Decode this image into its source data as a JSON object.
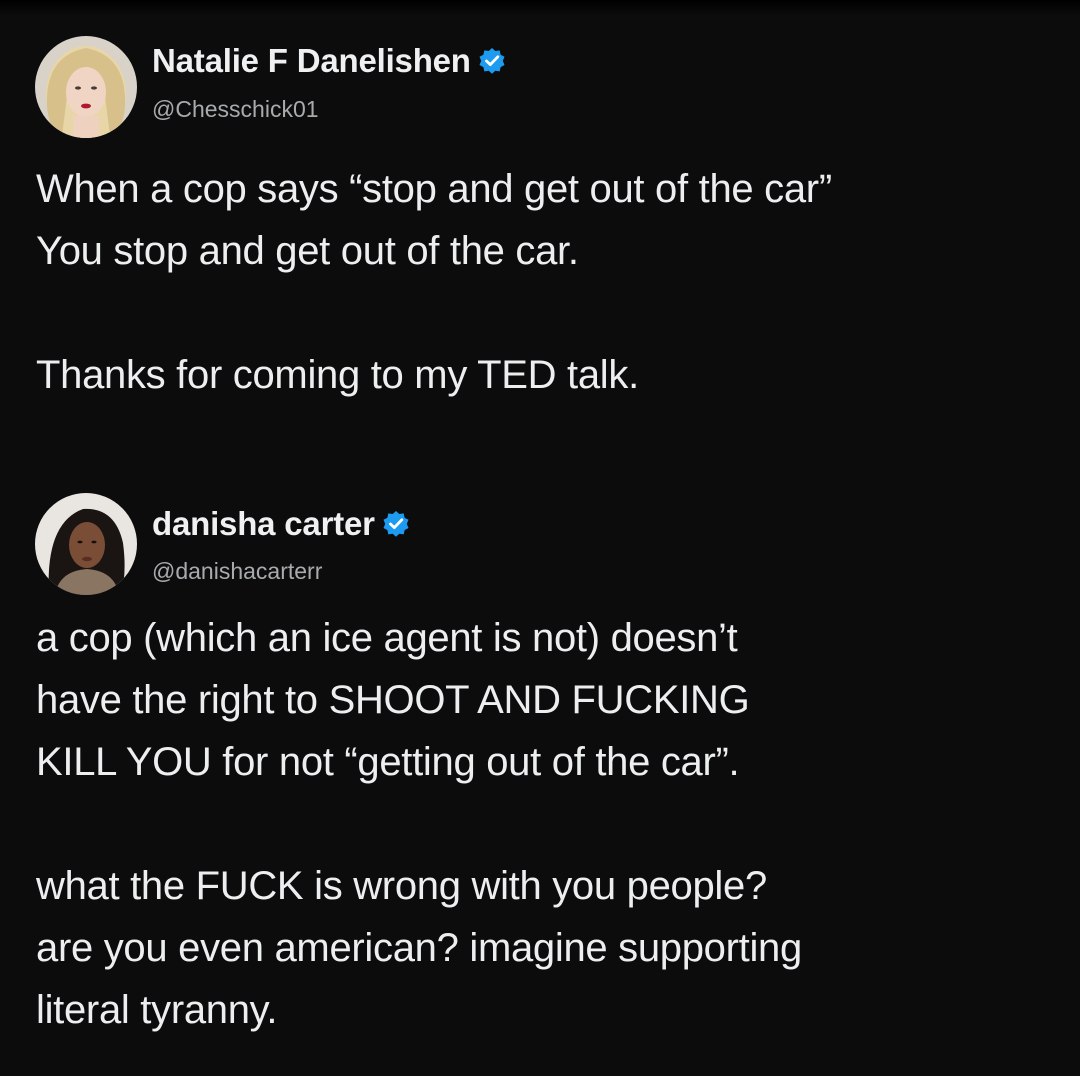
{
  "tweets": [
    {
      "display_name": "Natalie F Danelishen",
      "handle": "@Chesschick01",
      "verified": true,
      "avatar": "profile-photo",
      "paragraphs": [
        [
          "When a cop says “stop and get out of the car”",
          "You stop and get out of the car."
        ],
        [
          "Thanks for coming to my TED talk."
        ]
      ]
    },
    {
      "display_name": "danisha carter",
      "handle": "@danishacarterr",
      "verified": true,
      "avatar": "profile-photo",
      "paragraphs": [
        [
          "a cop (which an ice agent is not) doesn’t",
          "have the right to SHOOT AND FUCKING",
          "KILL YOU for not “getting out of the car”."
        ],
        [
          "what the FUCK is wrong with you people?",
          "are you even american? imagine supporting",
          "literal tyranny."
        ]
      ]
    }
  ],
  "colors": {
    "background": "#0c0c0c",
    "text": "#e7e9ea",
    "handle": "#a8abae",
    "verified_badge": "#1d9bf0"
  },
  "icons": {
    "verified": "verified-badge-icon"
  }
}
